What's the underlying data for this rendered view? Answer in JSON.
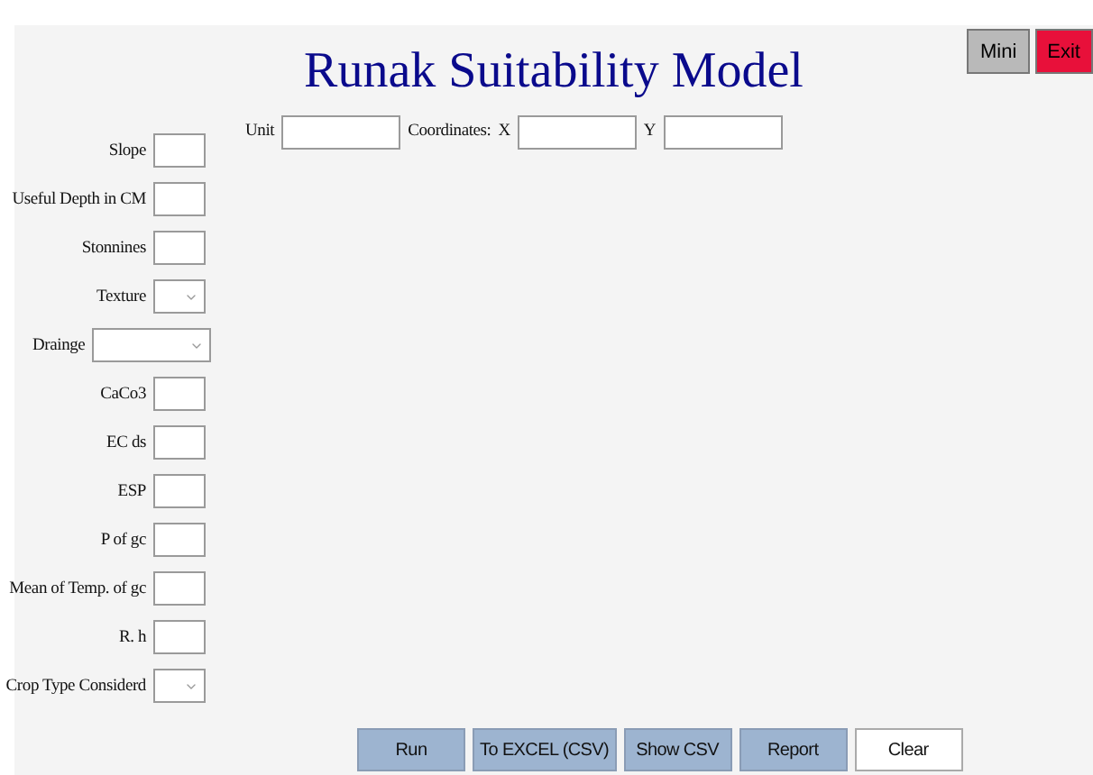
{
  "title": "Runak Suitability Model",
  "window_buttons": [
    {
      "label": "Mini",
      "kind": "mini"
    },
    {
      "label": "Exit",
      "kind": "exit"
    }
  ],
  "location": {
    "unit_label": "Unit",
    "coordinates_label": "Coordinates:",
    "x_label": "X",
    "y_label": "Y"
  },
  "fields": [
    {
      "label": "Slope",
      "kind": "text"
    },
    {
      "label": "Useful Depth in CM",
      "kind": "text"
    },
    {
      "label": "Stonnines",
      "kind": "text"
    },
    {
      "label": "Texture",
      "kind": "select"
    },
    {
      "label": "Drainge",
      "kind": "wide-select"
    },
    {
      "label": "CaCo3",
      "kind": "text"
    },
    {
      "label": "EC ds",
      "kind": "text"
    },
    {
      "label": "ESP",
      "kind": "text"
    },
    {
      "label": "P of gc",
      "kind": "text"
    },
    {
      "label": "Mean of Temp. of gc",
      "kind": "text"
    },
    {
      "label": "R. h",
      "kind": "text"
    },
    {
      "label": "Crop Type Considerd",
      "kind": "select"
    }
  ],
  "actions": [
    {
      "label": "Run",
      "kind": "primary"
    },
    {
      "label": "To EXCEL (CSV)",
      "kind": "primary"
    },
    {
      "label": "Show CSV",
      "kind": "primary"
    },
    {
      "label": "Report",
      "kind": "primary"
    },
    {
      "label": "Clear",
      "kind": "plain"
    }
  ]
}
